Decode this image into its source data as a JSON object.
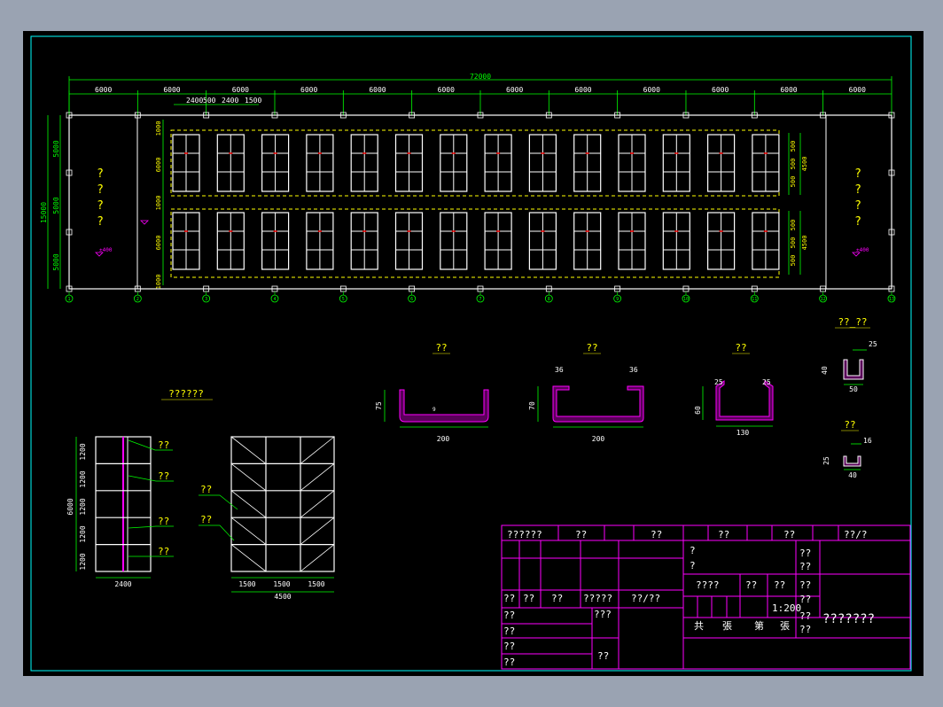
{
  "top_dims": {
    "total": "72000",
    "bays": [
      "6000",
      "6000",
      "6000",
      "6000",
      "6000",
      "6000",
      "6000",
      "6000",
      "6000",
      "6000",
      "6000",
      "6000"
    ],
    "sub": [
      "2400",
      "500",
      "2400",
      "1500"
    ]
  },
  "left_dims": {
    "total": "15000",
    "segs": [
      "5000",
      "5000",
      "5000"
    ]
  },
  "inner_left": [
    "1000",
    "6000",
    "1000",
    "6000",
    "1000"
  ],
  "right_dims": {
    "a": [
      "500",
      "500",
      "500"
    ],
    "b": "4500",
    "c": [
      "500",
      "500",
      "500"
    ],
    "d": "4500"
  },
  "axis_labels": [
    "1",
    "2",
    "3",
    "4",
    "5",
    "6",
    "7",
    "8",
    "9",
    "10",
    "11",
    "12",
    "13"
  ],
  "room_left_chars": [
    "?",
    "?",
    "?",
    "?"
  ],
  "room_right_chars": [
    "?",
    "?",
    "?",
    "?"
  ],
  "level_mark": "±400",
  "sections": {
    "channel1": {
      "title": "??",
      "w": "200",
      "h": "75",
      "t": "9"
    },
    "channel2": {
      "title": "??",
      "w": "200",
      "h": "70",
      "flange_l": "36",
      "flange_r": "36"
    },
    "channel3": {
      "title": "??",
      "w": "130",
      "h": "60",
      "flange_l": "25",
      "flange_r": "25"
    },
    "small1": {
      "title": "??_??",
      "w": "50",
      "h": "40",
      "flange": "25"
    },
    "small2": {
      "title": "??",
      "w": "40",
      "h": "25",
      "flange": "16"
    }
  },
  "elevation": {
    "title": "??????",
    "heights": [
      "1200",
      "1200",
      "1200",
      "1200",
      "1200"
    ],
    "total_h": "6000",
    "width": "2400",
    "callouts": [
      "??",
      "??",
      "??",
      "??"
    ],
    "side_callouts": [
      "??",
      "??"
    ],
    "side_bays": [
      "1500",
      "1500",
      "1500"
    ],
    "side_total": "4500"
  },
  "title_block": {
    "header": [
      "??????",
      "??",
      "??",
      "??",
      "??",
      "??/?"
    ],
    "r2": [
      "?",
      "?",
      "??",
      "??"
    ],
    "r3": [
      "????",
      "??",
      "??",
      "??"
    ],
    "r4": [
      "??",
      "??",
      "??",
      "?????",
      "??/??"
    ],
    "scale": "1:200",
    "pages": [
      "共",
      "張",
      "第",
      "張"
    ],
    "left_rows": [
      "??",
      "??",
      "??",
      "??"
    ],
    "mid": [
      "???",
      "??"
    ],
    "drawing_title": "???????",
    "side": [
      "??",
      "??"
    ]
  },
  "colors": {
    "frame": "#00ffff",
    "dim": "#00ff00",
    "struct": "#ffffff",
    "yellow": "#ffff00",
    "magenta": "#ff00ff",
    "red": "#ff0000",
    "green": "#00ff00"
  }
}
